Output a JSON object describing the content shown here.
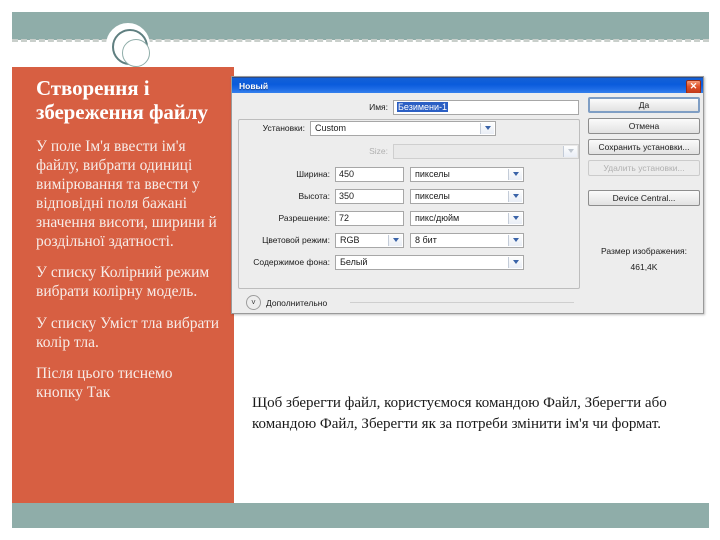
{
  "slide": {
    "sidebar": {
      "title": "Створення і збереження файлу",
      "paragraphs": [
        "У поле Ім'я ввести ім'я файлу, вибрати одиниці вимірювання та ввести у відповідні поля бажані значення висоти, ширини й роздільної здатності.",
        "У списку Колірний режим вибрати колірну модель.",
        "У списку Уміст тла вибрати колір тла.",
        "Після цього тиснемо кнопку Так"
      ]
    },
    "caption": "Щоб зберегти файл, користуємося командою Файл, Зберегти або командою Файл, Зберегти як за потреби змінити ім'я чи формат.",
    "colors": {
      "accent_orange": "#d75f42",
      "accent_teal": "#8fada9",
      "titlebar_blue": "#0a5bdc",
      "close_red": "#c0391a",
      "selection_blue": "#2b5fc4"
    }
  },
  "dialog": {
    "title": "Новый",
    "close_label": "✕",
    "name": {
      "label": "Имя:",
      "value": "Безимени-1"
    },
    "preset": {
      "label": "Установки:",
      "value": "Custom"
    },
    "size": {
      "label": "Size:",
      "value": ""
    },
    "width": {
      "label": "Ширина:",
      "value": "450",
      "unit": "пикселы"
    },
    "height": {
      "label": "Высота:",
      "value": "350",
      "unit": "пикселы"
    },
    "resolution": {
      "label": "Разрешение:",
      "value": "72",
      "unit": "пикс/дюйм"
    },
    "color_mode": {
      "label": "Цветовой режим:",
      "value": "RGB",
      "depth": "8 бит"
    },
    "background": {
      "label": "Содержимое фона:",
      "value": "Белый"
    },
    "advanced": {
      "label": "Дополнительно",
      "toggle_icon": "chevron-double-down-icon"
    },
    "buttons": {
      "ok": "Да",
      "cancel": "Отмена",
      "save_preset": "Сохранить установки...",
      "delete_preset": "Удалить установки...",
      "device_central": "Device Central..."
    },
    "image_size": {
      "label": "Размер изображения:",
      "value": "461,4K"
    }
  }
}
